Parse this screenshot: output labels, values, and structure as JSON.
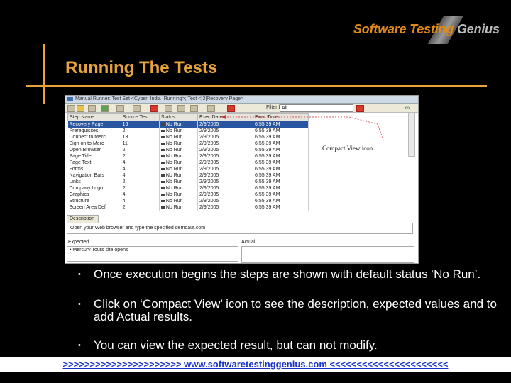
{
  "brand": {
    "logo_part1": "Software Testing",
    "logo_part2": "Genius"
  },
  "slide": {
    "title": "Running The Tests"
  },
  "screenshot": {
    "window_title": "Manual Runner: Test Set <Cyber_India_Running>; Test <[3]Recovery Page>",
    "filter_label": "Filter by:",
    "filter_value": "All",
    "columns": [
      "Step Name",
      "Source Test",
      "Status",
      "Exec Date",
      "Exec Time"
    ],
    "rows": [
      [
        "Recovery Page",
        "16",
        "No Run",
        "2/9/2005",
        "6:55:39 AM"
      ],
      [
        "Prerequisites",
        "2",
        "No Run",
        "2/9/2005",
        "6:55:39 AM"
      ],
      [
        "Connect to Merc",
        "13",
        "No Run",
        "2/9/2005",
        "6:55:39 AM"
      ],
      [
        "Sign on to Merc",
        "11",
        "No Run",
        "2/9/2005",
        "6:55:39 AM"
      ],
      [
        "Open Browser",
        "2",
        "No Run",
        "2/9/2005",
        "6:55:39 AM"
      ],
      [
        "Page Title",
        "2",
        "No Run",
        "2/9/2005",
        "6:55:39 AM"
      ],
      [
        "Page Text",
        "4",
        "No Run",
        "2/9/2005",
        "6:55:39 AM"
      ],
      [
        "Forms",
        "4",
        "No Run",
        "2/9/2005",
        "6:55:39 AM"
      ],
      [
        "Navigation Bars",
        "4",
        "No Run",
        "2/9/2005",
        "6:55:39 AM"
      ],
      [
        "Links",
        "2",
        "No Run",
        "2/9/2005",
        "6:55:39 AM"
      ],
      [
        "Company Logo",
        "2",
        "No Run",
        "2/9/2005",
        "6:55:39 AM"
      ],
      [
        "Graphics",
        "4",
        "No Run",
        "2/9/2005",
        "6:55:39 AM"
      ],
      [
        "Structure",
        "4",
        "No Run",
        "2/9/2005",
        "6:55:39 AM"
      ],
      [
        "Screen Area Def",
        "2",
        "No Run",
        "2/9/2005",
        "6:55:39 AM"
      ]
    ],
    "annotation": "Compact View icon",
    "description_tab": "Description",
    "description_text": "Open your Web browser and type the specified demoaut.com",
    "expected_label": "Expected",
    "actual_label": "Actual",
    "expected_text": "• Mercury Tours site opens"
  },
  "bullets": [
    "Once execution begins the steps are shown with default status ‘No Run’.",
    "Click on ‘Compact View’ icon to see the description, expected values and to add Actual results.",
    "You can view the expected result, but can not modify."
  ],
  "footer": ">>>>>>>>>>>>>>>>>>>>>>  www.softwaretestinggenius.com  <<<<<<<<<<<<<<<<<<<<<<"
}
